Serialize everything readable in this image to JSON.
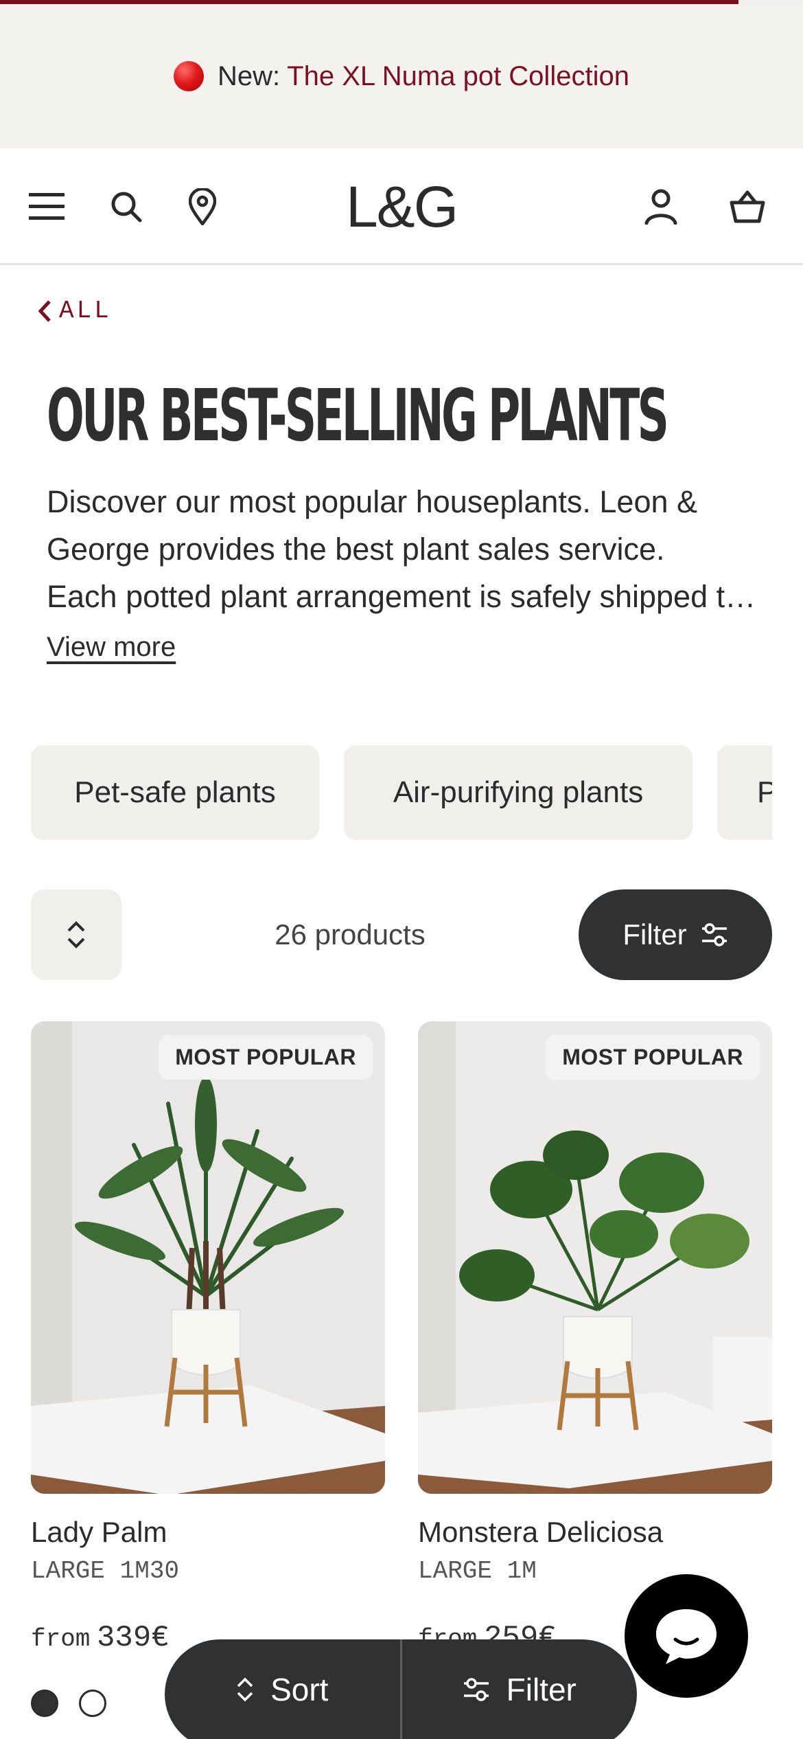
{
  "announcement": {
    "prefix": "New:",
    "link_text": "The XL Numa pot Collection",
    "scroll_progress": 0.92
  },
  "header": {
    "logo": "L&G",
    "icons": [
      "menu-icon",
      "search-icon",
      "location-icon",
      "account-icon",
      "basket-icon"
    ]
  },
  "breadcrumb": {
    "back_label": "ALL"
  },
  "page": {
    "title": "OUR BEST-SELLING PLANTS",
    "description_line1": "Discover our most popular houseplants. Leon &",
    "description_line2": "George provides the best plant sales service.",
    "description_line3": "Each potted plant arrangement is safely shipped to your door.",
    "view_more": "View more"
  },
  "categories": [
    "Pet-safe plants",
    "Air-purifying plants",
    "Pet-friendly"
  ],
  "toolbar": {
    "count": "26 products",
    "filter_label": "Filter"
  },
  "products": [
    {
      "badge": "MOST POPULAR",
      "name": "Lady Palm",
      "size": "LARGE 1M30",
      "price_prefix": "from",
      "price": "339€"
    },
    {
      "badge": "MOST POPULAR",
      "name": "Monstera Deliciosa",
      "size": "LARGE 1M",
      "price_prefix": "from",
      "price": "259€"
    }
  ],
  "swatches": [
    "#2f3133",
    "#ffffff"
  ],
  "bottom_bar": {
    "sort_label": "Sort",
    "filter_label": "Filter"
  },
  "colors": {
    "accent": "#7a1021",
    "dark": "#2f3133",
    "chip_bg": "#f0efec"
  }
}
